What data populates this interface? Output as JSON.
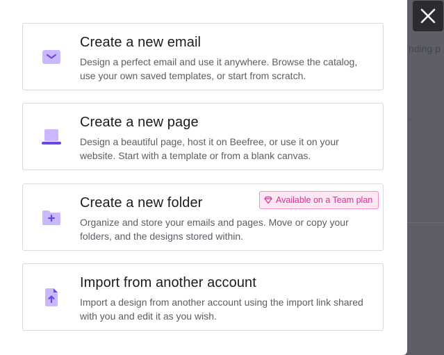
{
  "background": {
    "partial_text_1": "nding p",
    "partial_text_2": "."
  },
  "close_button": {
    "label": "Close"
  },
  "cards": [
    {
      "title": "Create a new email",
      "description": "Design a perfect email and use it anywhere. Browse the catalog, use your own saved templates, or start from scratch.",
      "icon": "envelope-icon"
    },
    {
      "title": "Create a new page",
      "description": "Design a beautiful page, host it on Beefree, or use it on your website. Start with a template or from a blank canvas.",
      "icon": "laptop-icon"
    },
    {
      "title": "Create a new folder",
      "description": "Organize and store your emails and pages. Move or copy your folders, and the designs stored within.",
      "icon": "folder-plus-icon",
      "badge": "Available on a Team plan"
    },
    {
      "title": "Import from another account",
      "description": "Import a design from another account using the import link shared with you and edit it as you wish.",
      "icon": "file-upload-icon"
    }
  ],
  "colors": {
    "accent": "#7b5cf0",
    "accent_light": "#c9b8fb",
    "badge_text": "#d6309a",
    "badge_bg": "#fde7f3",
    "overlay": "#5d5e66"
  }
}
